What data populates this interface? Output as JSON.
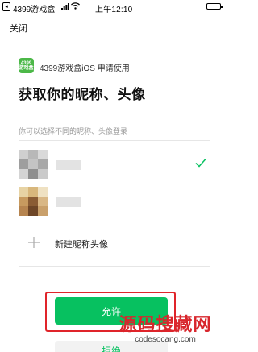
{
  "status_bar": {
    "back_glyph": "◂",
    "carrier": "4399游戏盒",
    "time": "上午12:10",
    "icons": [
      "signal-icon",
      "wifi-icon",
      "battery-icon"
    ]
  },
  "nav": {
    "close_label": "关闭"
  },
  "app": {
    "logo_lines": [
      "4399",
      "游戏盒"
    ],
    "name": "4399游戏盒iOS 申请使用",
    "brand_color": "#4cb848"
  },
  "title": "获取你的昵称、头像",
  "hint": "你可以选择不同的昵称、头像登录",
  "accounts": [
    {
      "nickname": "",
      "selected": true,
      "check_icon": "check-icon"
    },
    {
      "nickname": "",
      "selected": false
    }
  ],
  "new_account": {
    "label": "新建昵称头像",
    "icon": "plus-icon"
  },
  "buttons": {
    "allow_label": "允许",
    "reject_label": "拒绝",
    "accent": "#07c160"
  },
  "watermark": {
    "main": "源码搜藏网",
    "url": "codesocang.com"
  }
}
